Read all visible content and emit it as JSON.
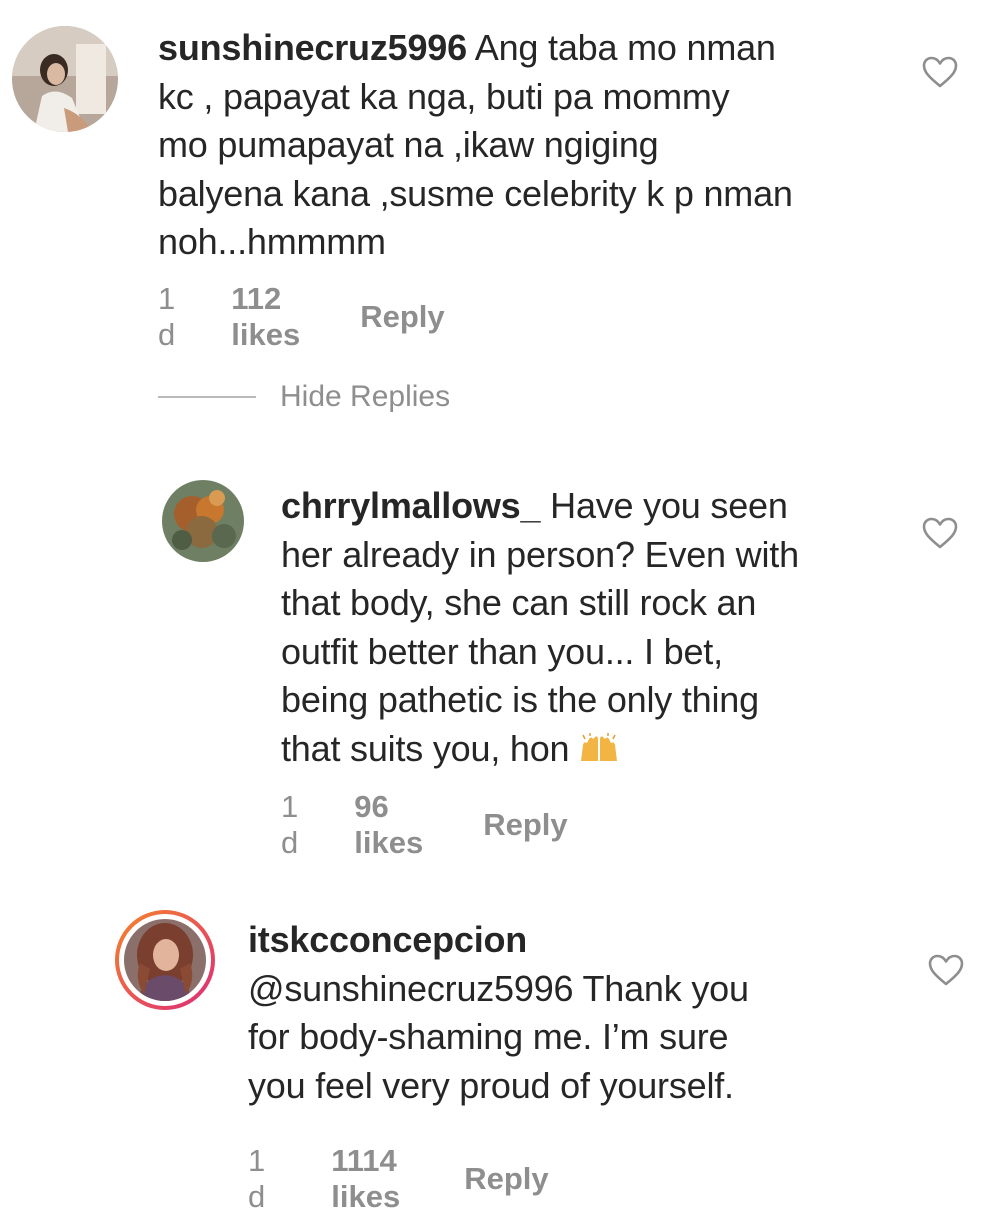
{
  "comments": [
    {
      "username": "sunshinecruz5996",
      "lines": [
        "Ang taba mo nman",
        "kc , papayat ka nga, buti pa mommy",
        "mo pumapayat na ,ikaw ngiging",
        "balyena kana ,susme celebrity k p nman",
        "noh...hmmmm"
      ],
      "time": "1 d",
      "likes": "112 likes",
      "reply": "Reply",
      "icon": "heart-outline-icon"
    },
    {
      "username": "chrrylmallows_",
      "lines": [
        "Have you seen",
        "her already in person? Even with",
        "that body, she can still rock an",
        "outfit better than you... I bet,",
        "being pathetic is the only thing",
        "that suits you, hon"
      ],
      "emoji": "raising-hands-emoji",
      "time": "1 d",
      "likes": "96 likes",
      "reply": "Reply",
      "icon": "heart-outline-icon"
    },
    {
      "username": "itskcconcepcion",
      "lines": [
        "@sunshinecruz5996 Thank you",
        "for body-shaming me. I’m sure",
        "you feel very proud of yourself."
      ],
      "time": "1 d",
      "likes": "1114 likes",
      "reply": "Reply",
      "icon": "heart-outline-icon"
    }
  ],
  "hide_replies": "Hide Replies",
  "colors": {
    "text": "#262626",
    "meta": "#8e8e8e",
    "story_ring_start": "#f58529",
    "story_ring_end": "#dd2a7b"
  }
}
